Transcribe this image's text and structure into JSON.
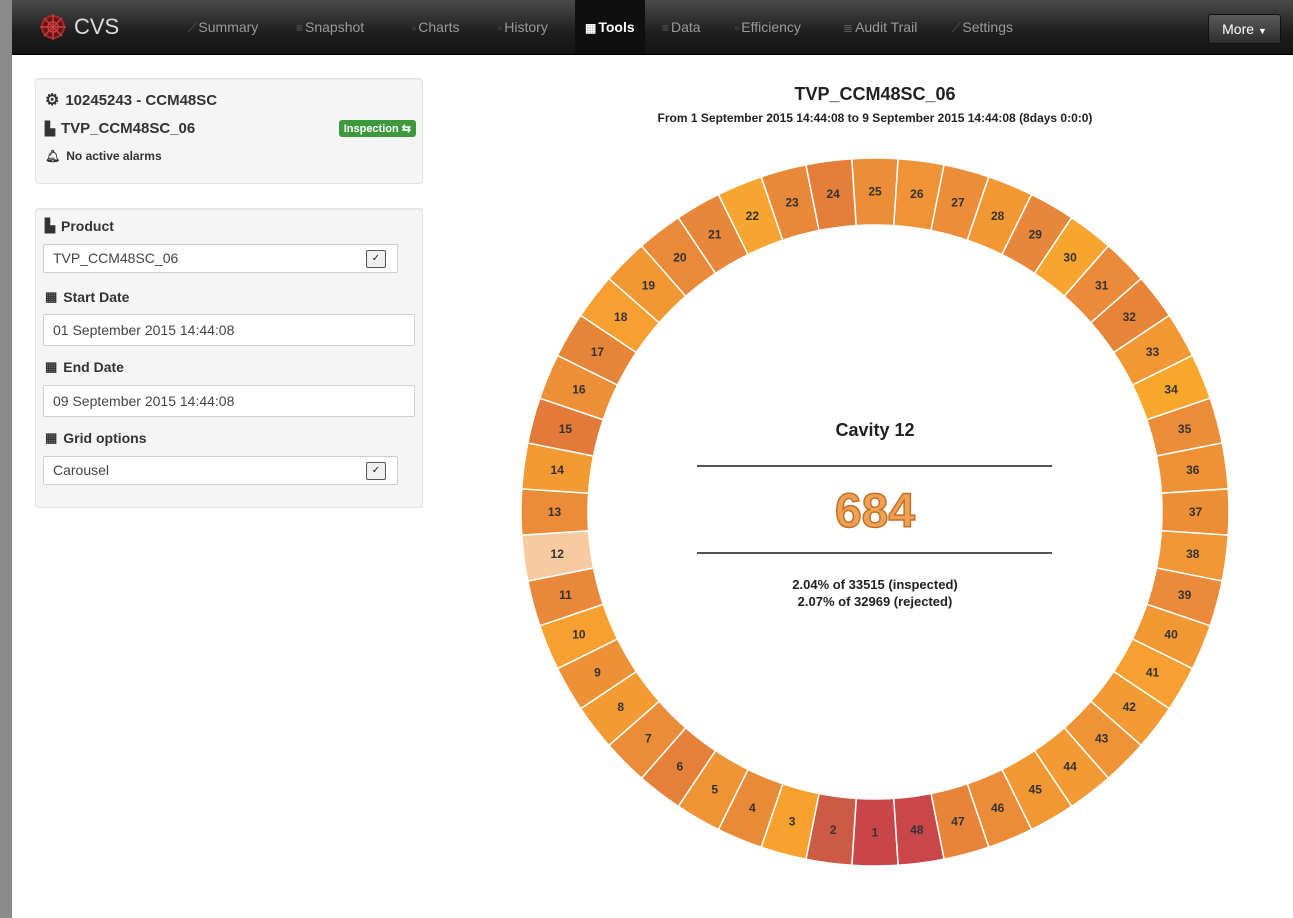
{
  "app": {
    "brand": "CVS"
  },
  "nav": {
    "items": [
      {
        "label": "Summary",
        "icon": "summary-icon"
      },
      {
        "label": "Snapshot",
        "icon": "list-icon"
      },
      {
        "label": "Charts",
        "icon": "chart-icon"
      },
      {
        "label": "History",
        "icon": "history-icon"
      },
      {
        "label": "Tools",
        "icon": "grid-icon",
        "active": true
      },
      {
        "label": "Data",
        "icon": "list-icon"
      },
      {
        "label": "Efficiency",
        "icon": "efficiency-icon"
      },
      {
        "label": "Audit Trail",
        "icon": "audit-icon"
      },
      {
        "label": "Settings",
        "icon": "wrench-icon"
      }
    ],
    "more_label": "More"
  },
  "machine_panel": {
    "machine": "10245243 - CCM48SC",
    "product": "TVP_CCM48SC_06",
    "badge": "Inspection",
    "alarms": "No active alarms"
  },
  "options_panel": {
    "product_label": "Product",
    "product_value": "TVP_CCM48SC_06",
    "start_label": "Start Date",
    "start_value": "01 September 2015 14:44:08",
    "end_label": "End Date",
    "end_value": "09 September 2015 14:44:08",
    "grid_label": "Grid options",
    "grid_value": "Carousel"
  },
  "chart": {
    "title": "TVP_CCM48SC_06",
    "subtitle": "From 1 September 2015 14:44:08 to 9 September 2015 14:44:08 (8days 0:0:0)",
    "selected_label": "Cavity 12",
    "selected_value": "684",
    "inspected_line": "2.04% of 33515 (inspected)",
    "rejected_line": "2.07% of 32969 (rejected)"
  },
  "chart_data": {
    "type": "radial",
    "selected": 12,
    "segments": [
      {
        "label": "1",
        "color": "#c8464a"
      },
      {
        "label": "2",
        "color": "#cc5a44"
      },
      {
        "label": "3",
        "color": "#f7a22e"
      },
      {
        "label": "4",
        "color": "#e98a36"
      },
      {
        "label": "5",
        "color": "#ee9435"
      },
      {
        "label": "6",
        "color": "#e68038"
      },
      {
        "label": "7",
        "color": "#ea8c38"
      },
      {
        "label": "8",
        "color": "#f39b33"
      },
      {
        "label": "9",
        "color": "#ee9035"
      },
      {
        "label": "10",
        "color": "#f6a02f"
      },
      {
        "label": "11",
        "color": "#e98838"
      },
      {
        "label": "12",
        "color": "#f8caa0"
      },
      {
        "label": "13",
        "color": "#ec8c38"
      },
      {
        "label": "14",
        "color": "#f39a33"
      },
      {
        "label": "15",
        "color": "#e47a3a"
      },
      {
        "label": "16",
        "color": "#ec8f36"
      },
      {
        "label": "17",
        "color": "#e68438"
      },
      {
        "label": "18",
        "color": "#f5a030"
      },
      {
        "label": "19",
        "color": "#f29833"
      },
      {
        "label": "20",
        "color": "#ea8a38"
      },
      {
        "label": "21",
        "color": "#e8863a"
      },
      {
        "label": "22",
        "color": "#f6a530"
      },
      {
        "label": "23",
        "color": "#e98838"
      },
      {
        "label": "24",
        "color": "#e47e3a"
      },
      {
        "label": "25",
        "color": "#ec8e38"
      },
      {
        "label": "26",
        "color": "#f09236"
      },
      {
        "label": "27",
        "color": "#ec8d38"
      },
      {
        "label": "28",
        "color": "#f19835"
      },
      {
        "label": "29",
        "color": "#e8873a"
      },
      {
        "label": "30",
        "color": "#f7a52f"
      },
      {
        "label": "31",
        "color": "#eb8a38"
      },
      {
        "label": "32",
        "color": "#e88438"
      },
      {
        "label": "33",
        "color": "#f19835"
      },
      {
        "label": "34",
        "color": "#f8a72d"
      },
      {
        "label": "35",
        "color": "#eb8c38"
      },
      {
        "label": "36",
        "color": "#ef9236"
      },
      {
        "label": "37",
        "color": "#ed8e37"
      },
      {
        "label": "38",
        "color": "#f09636"
      },
      {
        "label": "39",
        "color": "#eb8a38"
      },
      {
        "label": "40",
        "color": "#f19734"
      },
      {
        "label": "41",
        "color": "#f5a031"
      },
      {
        "label": "42",
        "color": "#f29a33"
      },
      {
        "label": "43",
        "color": "#ef9436"
      },
      {
        "label": "44",
        "color": "#f29a34"
      },
      {
        "label": "45",
        "color": "#f19835"
      },
      {
        "label": "46",
        "color": "#ec8c38"
      },
      {
        "label": "47",
        "color": "#e8843a"
      },
      {
        "label": "48",
        "color": "#c9474a"
      }
    ]
  },
  "colors": {
    "accent": "#f08c2c",
    "badge": "#3c9a3c"
  }
}
